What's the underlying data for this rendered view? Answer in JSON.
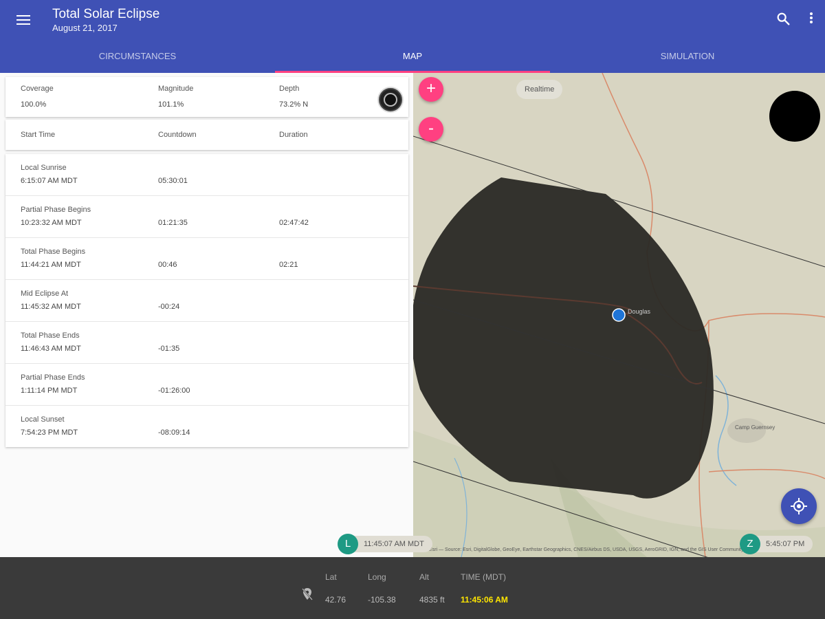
{
  "app": {
    "title": "Total Solar Eclipse",
    "subtitle": "August 21, 2017"
  },
  "tabs": [
    {
      "label": "CIRCUMSTANCES",
      "active": false
    },
    {
      "label": "MAP",
      "active": true
    },
    {
      "label": "SIMULATION",
      "active": false
    }
  ],
  "summary": {
    "coverage_label": "Coverage",
    "coverage_value": "100.0%",
    "magnitude_label": "Magnitude",
    "magnitude_value": "101.1%",
    "depth_label": "Depth",
    "depth_value": "73.2% N"
  },
  "table_header": {
    "start_time": "Start Time",
    "countdown": "Countdown",
    "duration": "Duration"
  },
  "events": [
    {
      "name": "Local Sunrise",
      "time": "6:15:07 AM MDT",
      "countdown": "05:30:01",
      "duration": ""
    },
    {
      "name": "Partial Phase Begins",
      "time": "10:23:32 AM MDT",
      "countdown": "01:21:35",
      "duration": "02:47:42"
    },
    {
      "name": "Total Phase Begins",
      "time": "11:44:21 AM MDT",
      "countdown": "00:46",
      "duration": "02:21"
    },
    {
      "name": "Mid Eclipse At",
      "time": "11:45:32 AM MDT",
      "countdown": "-00:24",
      "duration": ""
    },
    {
      "name": "Total Phase Ends",
      "time": "11:46:43 AM MDT",
      "countdown": "-01:35",
      "duration": ""
    },
    {
      "name": "Partial Phase Ends",
      "time": "1:11:14 PM MDT",
      "countdown": "-01:26:00",
      "duration": ""
    },
    {
      "name": "Local Sunset",
      "time": "7:54:23 PM MDT",
      "countdown": "-08:09:14",
      "duration": ""
    }
  ],
  "map": {
    "zoom_in": "+",
    "zoom_out": "-",
    "realtime": "Realtime",
    "town_label": "Douglas",
    "reservoir_label": "Camp Guernsey",
    "attribution": "© Esri — Source: Esri, DigitalGlobe, GeoEye, Earthstar Geographics, CNES/Airbus DS, USDA, USGS, AeroGRID, IGN, and the GIS User Community"
  },
  "time_chips": {
    "left_letter": "L",
    "left_time": "11:45:07 AM MDT",
    "right_letter": "Z",
    "right_time": "5:45:07 PM"
  },
  "location": {
    "lat_label": "Lat",
    "lat_value": "42.76",
    "long_label": "Long",
    "long_value": "-105.38",
    "alt_label": "Alt",
    "alt_value": "4835 ft",
    "time_label": "TIME (MDT)",
    "time_value": "11:45:06 AM"
  },
  "colors": {
    "primary": "#3f51b5",
    "accent": "#ff4081",
    "chip": "#1e9a84",
    "time_highlight": "#ffe600"
  },
  "icons": [
    "menu-icon",
    "search-icon",
    "more-vert-icon",
    "eclipse-icon",
    "gps-locate-icon",
    "location-off-icon"
  ]
}
